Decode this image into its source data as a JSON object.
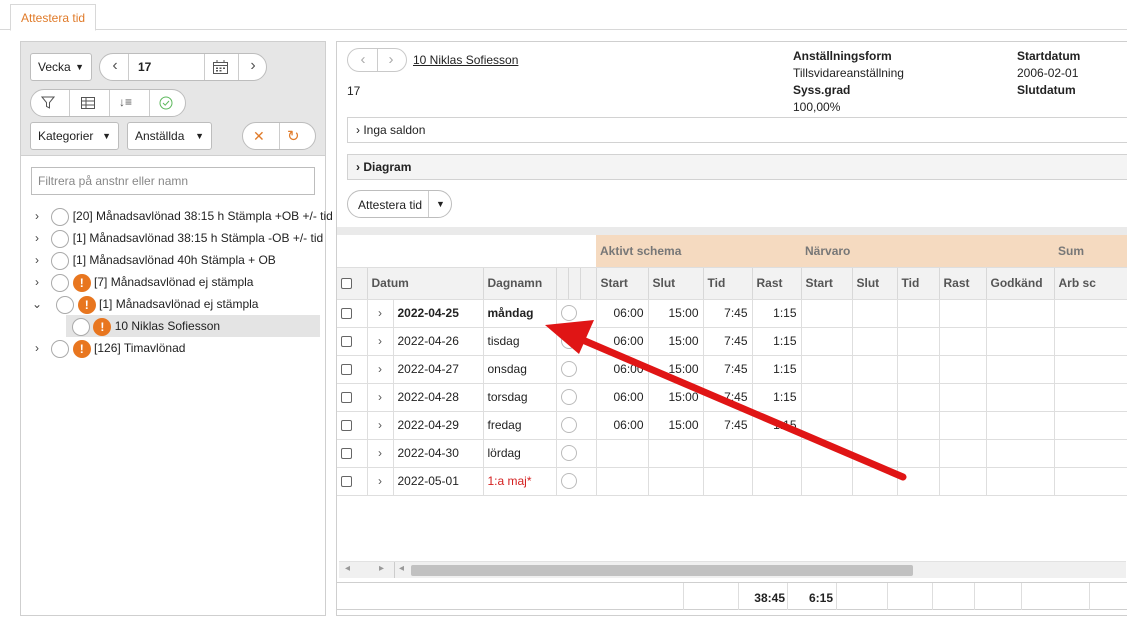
{
  "tab": {
    "label": "Attestera tid"
  },
  "left": {
    "period_select": "Vecka",
    "week_value": "17",
    "kategorier": "Kategorier",
    "anstallda": "Anställda",
    "filter_placeholder": "Filtrera på anstnr eller namn",
    "tree": [
      {
        "label": "[20]  Månadsavlönad 38:15 h Stämpla +OB +/- tid",
        "warn": false
      },
      {
        "label": "[1]  Månadsavlönad 38:15 h Stämpla -OB +/- tid",
        "warn": false
      },
      {
        "label": "[1]  Månadsavlönad 40h Stämpla + OB",
        "warn": false
      },
      {
        "label": "[7]  Månadsavlönad ej stämpla",
        "warn": true
      },
      {
        "label": "[1]  Månadsavlönad ej stämpla",
        "warn": true,
        "expanded": true
      },
      {
        "label": "10 Niklas Sofiesson",
        "warn": true,
        "child": true
      },
      {
        "label": "[126]  Timavlönad",
        "warn": true
      }
    ]
  },
  "employee": {
    "name": "10 Niklas Sofiesson",
    "week": "17",
    "anstallningsform_label": "Anställningsform",
    "anstallningsform_value": "Tillsvidareanställning",
    "syssgrad_label": "Syss.grad",
    "syssgrad_value": "100,00%",
    "startdatum_label": "Startdatum",
    "startdatum_value": "2006-02-01",
    "slutdatum_label": "Slutdatum"
  },
  "saldon": "Inga saldon",
  "diagram": "Diagram",
  "attest_button": "Attestera tid",
  "grid": {
    "groups": {
      "aktivt": "Aktivt schema",
      "narvaro": "Närvaro",
      "sum": "Sum"
    },
    "columns": [
      "Datum",
      "Dagnamn",
      "Start",
      "Slut",
      "Tid",
      "Rast",
      "Start",
      "Slut",
      "Tid",
      "Rast",
      "Godkänd",
      "Arb sc"
    ],
    "rows": [
      {
        "datum": "2022-04-25",
        "dag": "måndag",
        "start": "06:00",
        "slut": "15:00",
        "tid": "7:45",
        "rast": "1:15",
        "bold": true
      },
      {
        "datum": "2022-04-26",
        "dag": "tisdag",
        "start": "06:00",
        "slut": "15:00",
        "tid": "7:45",
        "rast": "1:15"
      },
      {
        "datum": "2022-04-27",
        "dag": "onsdag",
        "start": "06:00",
        "slut": "15:00",
        "tid": "7:45",
        "rast": "1:15"
      },
      {
        "datum": "2022-04-28",
        "dag": "torsdag",
        "start": "06:00",
        "slut": "15:00",
        "tid": "7:45",
        "rast": "1:15"
      },
      {
        "datum": "2022-04-29",
        "dag": "fredag",
        "start": "06:00",
        "slut": "15:00",
        "tid": "7:45",
        "rast": "1:15"
      },
      {
        "datum": "2022-04-30",
        "dag": "lördag",
        "start": "",
        "slut": "",
        "tid": "",
        "rast": ""
      },
      {
        "datum": "2022-05-01",
        "dag": "1:a maj*",
        "start": "",
        "slut": "",
        "tid": "",
        "rast": "",
        "holiday": true
      }
    ],
    "totals": {
      "tid": "38:45",
      "rast": "6:15"
    }
  },
  "colors": {
    "accent": "#e07b2a",
    "warn": "#e8761f",
    "arrow": "#e01515",
    "holiday": "#d42020"
  }
}
